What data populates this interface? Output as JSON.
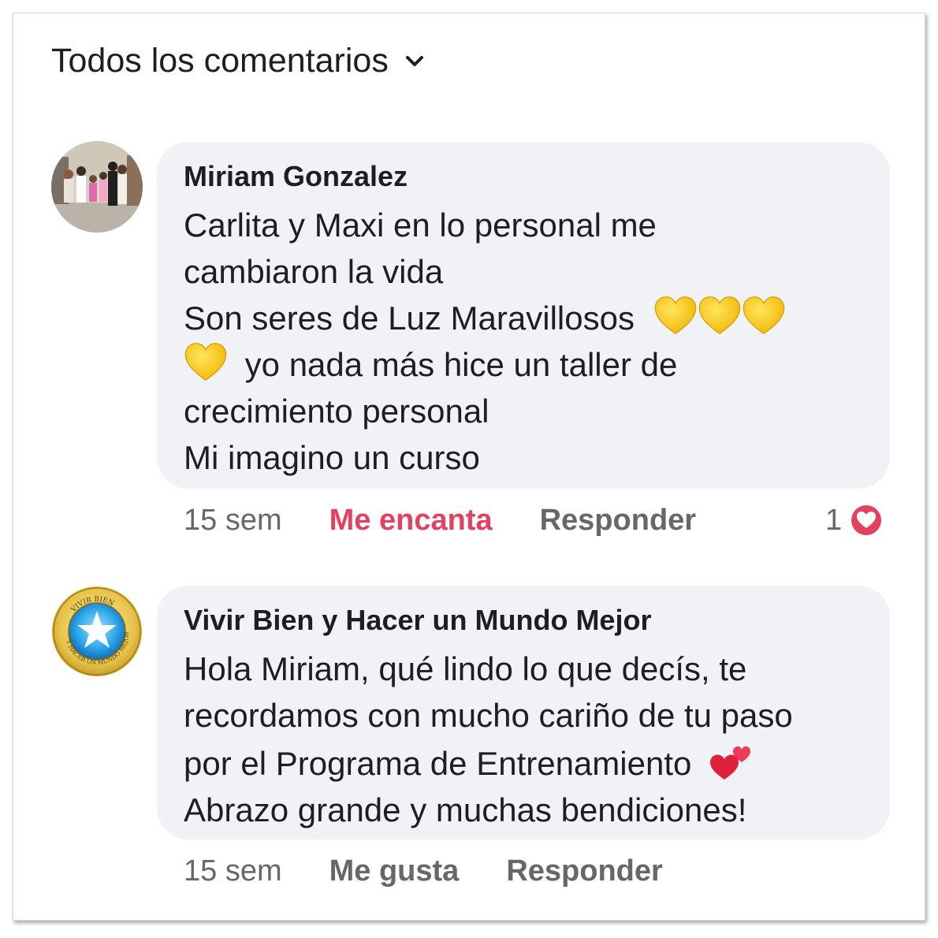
{
  "header": {
    "filter_label": "Todos los comentarios",
    "filter_icon": "chevron-down-icon"
  },
  "comments": [
    {
      "author": "Miriam Gonzalez",
      "text_lines": [
        "Carlita y Maxi  en lo personal  me",
        "cambiaron la vida",
        "Son seres de Luz  Maravillosos",
        "yo nada más hice un taller de",
        "crecimiento  personal",
        "Mi imagino  un curso"
      ],
      "emojis": [
        "yellow-heart",
        "yellow-heart",
        "yellow-heart",
        "yellow-heart"
      ],
      "time": "15 sem",
      "reaction_action": "Me encanta",
      "reply_action": "Responder",
      "reaction_count": "1",
      "reaction_icon": "love-reaction-icon",
      "reaction_color": "#e4405f"
    },
    {
      "author": "Vivir Bien y Hacer un Mundo Mejor",
      "avatar_text": "VIVIR BIEN · Y HACER UN MUNDO MEJOR",
      "text_lines": [
        "Hola Miriam, qué lindo lo que decís, te",
        "recordamos con mucho cariño de tu paso",
        "por el Programa de Entrenamiento",
        "Abrazo grande y muchas bendiciones!"
      ],
      "emojis": [
        "two-hearts"
      ],
      "time": "15 sem",
      "reaction_action": "Me gusta",
      "reply_action": "Responder"
    }
  ],
  "colors": {
    "bubble": "#f0f2f5",
    "text": "#1c1e21",
    "secondary": "#65676b",
    "love": "#e4405f"
  }
}
